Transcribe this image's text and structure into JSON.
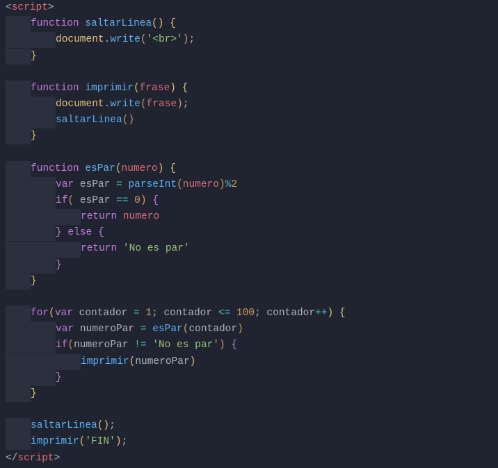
{
  "code": {
    "lines": [
      {
        "indent": 0,
        "tokens": [
          {
            "t": "<",
            "c": "punct"
          },
          {
            "t": "script",
            "c": "tag"
          },
          {
            "t": ">",
            "c": "punct"
          }
        ]
      },
      {
        "indent": 1,
        "tokens": [
          {
            "t": "function ",
            "c": "keyword"
          },
          {
            "t": "saltarLinea",
            "c": "funcdef"
          },
          {
            "t": "(",
            "c": "paren-y"
          },
          {
            "t": ")",
            "c": "paren-y"
          },
          {
            "t": " ",
            "c": ""
          },
          {
            "t": "{",
            "c": "brace-y"
          }
        ]
      },
      {
        "indent": 2,
        "tokens": [
          {
            "t": "document",
            "c": "object"
          },
          {
            "t": ".",
            "c": "punct"
          },
          {
            "t": "write",
            "c": "method"
          },
          {
            "t": "(",
            "c": "paren"
          },
          {
            "t": "'<br>'",
            "c": "string"
          },
          {
            "t": ")",
            "c": "paren"
          },
          {
            "t": ";",
            "c": "punct"
          }
        ]
      },
      {
        "indent": 1,
        "tokens": [
          {
            "t": "}",
            "c": "brace-y"
          }
        ]
      },
      {
        "indent": 0,
        "tokens": []
      },
      {
        "indent": 1,
        "tokens": [
          {
            "t": "function ",
            "c": "keyword"
          },
          {
            "t": "imprimir",
            "c": "funcdef"
          },
          {
            "t": "(",
            "c": "paren-y"
          },
          {
            "t": "frase",
            "c": "param"
          },
          {
            "t": ")",
            "c": "paren-y"
          },
          {
            "t": " ",
            "c": ""
          },
          {
            "t": "{",
            "c": "brace-y"
          }
        ]
      },
      {
        "indent": 2,
        "tokens": [
          {
            "t": "document",
            "c": "object"
          },
          {
            "t": ".",
            "c": "punct"
          },
          {
            "t": "write",
            "c": "method"
          },
          {
            "t": "(",
            "c": "paren"
          },
          {
            "t": "frase",
            "c": "param"
          },
          {
            "t": ")",
            "c": "paren"
          },
          {
            "t": ";",
            "c": "punct"
          }
        ]
      },
      {
        "indent": 2,
        "tokens": [
          {
            "t": "saltarLinea",
            "c": "funccall"
          },
          {
            "t": "(",
            "c": "paren"
          },
          {
            "t": ")",
            "c": "paren"
          }
        ]
      },
      {
        "indent": 1,
        "tokens": [
          {
            "t": "}",
            "c": "brace-y"
          }
        ]
      },
      {
        "indent": 0,
        "tokens": []
      },
      {
        "indent": 1,
        "tokens": [
          {
            "t": "function ",
            "c": "keyword"
          },
          {
            "t": "esPar",
            "c": "funcdef"
          },
          {
            "t": "(",
            "c": "paren-y"
          },
          {
            "t": "numero",
            "c": "param"
          },
          {
            "t": ")",
            "c": "paren-y"
          },
          {
            "t": " ",
            "c": ""
          },
          {
            "t": "{",
            "c": "brace-y"
          }
        ]
      },
      {
        "indent": 2,
        "tokens": [
          {
            "t": "var ",
            "c": "keyword"
          },
          {
            "t": "esPar",
            "c": "localvar"
          },
          {
            "t": " ",
            "c": ""
          },
          {
            "t": "=",
            "c": "op"
          },
          {
            "t": " ",
            "c": ""
          },
          {
            "t": "parseInt",
            "c": "funccall"
          },
          {
            "t": "(",
            "c": "paren"
          },
          {
            "t": "numero",
            "c": "param"
          },
          {
            "t": ")",
            "c": "paren"
          },
          {
            "t": "%",
            "c": "op"
          },
          {
            "t": "2",
            "c": "number"
          }
        ]
      },
      {
        "indent": 2,
        "tokens": [
          {
            "t": "if",
            "c": "keyword"
          },
          {
            "t": "(",
            "c": "paren"
          },
          {
            "t": " ",
            "c": ""
          },
          {
            "t": "esPar",
            "c": "localvar"
          },
          {
            "t": " ",
            "c": ""
          },
          {
            "t": "==",
            "c": "op"
          },
          {
            "t": " ",
            "c": ""
          },
          {
            "t": "0",
            "c": "number"
          },
          {
            "t": ")",
            "c": "paren"
          },
          {
            "t": " ",
            "c": ""
          },
          {
            "t": "{",
            "c": "brace-p"
          }
        ]
      },
      {
        "indent": 3,
        "tokens": [
          {
            "t": "return ",
            "c": "keyword"
          },
          {
            "t": "numero",
            "c": "param"
          }
        ]
      },
      {
        "indent": 2,
        "tokens": [
          {
            "t": "}",
            "c": "brace-p"
          },
          {
            "t": " ",
            "c": ""
          },
          {
            "t": "else ",
            "c": "keyword"
          },
          {
            "t": "{",
            "c": "brace-p"
          }
        ]
      },
      {
        "indent": 3,
        "tokens": [
          {
            "t": "return ",
            "c": "keyword"
          },
          {
            "t": "'No es par'",
            "c": "string"
          }
        ]
      },
      {
        "indent": 2,
        "tokens": [
          {
            "t": "}",
            "c": "brace-p"
          }
        ]
      },
      {
        "indent": 1,
        "tokens": [
          {
            "t": "}",
            "c": "brace-y"
          }
        ]
      },
      {
        "indent": 0,
        "tokens": []
      },
      {
        "indent": 1,
        "tokens": [
          {
            "t": "for",
            "c": "keyword"
          },
          {
            "t": "(",
            "c": "paren-y"
          },
          {
            "t": "var ",
            "c": "keyword"
          },
          {
            "t": "contador",
            "c": "localvar"
          },
          {
            "t": " ",
            "c": ""
          },
          {
            "t": "=",
            "c": "op"
          },
          {
            "t": " ",
            "c": ""
          },
          {
            "t": "1",
            "c": "number"
          },
          {
            "t": "; ",
            "c": "punct"
          },
          {
            "t": "contador",
            "c": "localvar"
          },
          {
            "t": " ",
            "c": ""
          },
          {
            "t": "<=",
            "c": "op"
          },
          {
            "t": " ",
            "c": ""
          },
          {
            "t": "100",
            "c": "number"
          },
          {
            "t": "; ",
            "c": "punct"
          },
          {
            "t": "contador",
            "c": "localvar"
          },
          {
            "t": "++",
            "c": "op"
          },
          {
            "t": ")",
            "c": "paren-y"
          },
          {
            "t": " ",
            "c": ""
          },
          {
            "t": "{",
            "c": "brace-y"
          }
        ]
      },
      {
        "indent": 2,
        "tokens": [
          {
            "t": "var ",
            "c": "keyword"
          },
          {
            "t": "numeroPar",
            "c": "localvar"
          },
          {
            "t": " ",
            "c": ""
          },
          {
            "t": "=",
            "c": "op"
          },
          {
            "t": " ",
            "c": ""
          },
          {
            "t": "esPar",
            "c": "funccall"
          },
          {
            "t": "(",
            "c": "paren"
          },
          {
            "t": "contador",
            "c": "localvar"
          },
          {
            "t": ")",
            "c": "paren"
          }
        ]
      },
      {
        "indent": 2,
        "tokens": [
          {
            "t": "if",
            "c": "keyword"
          },
          {
            "t": "(",
            "c": "paren"
          },
          {
            "t": "numeroPar",
            "c": "localvar"
          },
          {
            "t": " ",
            "c": ""
          },
          {
            "t": "!=",
            "c": "op"
          },
          {
            "t": " ",
            "c": ""
          },
          {
            "t": "'No es par'",
            "c": "string"
          },
          {
            "t": ")",
            "c": "paren"
          },
          {
            "t": " ",
            "c": ""
          },
          {
            "t": "{",
            "c": "brace-p"
          }
        ]
      },
      {
        "indent": 3,
        "tokens": [
          {
            "t": "imprimir",
            "c": "funccall"
          },
          {
            "t": "(",
            "c": "paren-y"
          },
          {
            "t": "numeroPar",
            "c": "localvar"
          },
          {
            "t": ")",
            "c": "paren-y"
          }
        ]
      },
      {
        "indent": 2,
        "tokens": [
          {
            "t": "}",
            "c": "brace-p"
          }
        ]
      },
      {
        "indent": 1,
        "tokens": [
          {
            "t": "}",
            "c": "brace-y"
          }
        ]
      },
      {
        "indent": 0,
        "tokens": []
      },
      {
        "indent": 1,
        "tokens": [
          {
            "t": "saltarLinea",
            "c": "funccall"
          },
          {
            "t": "(",
            "c": "paren-y"
          },
          {
            "t": ")",
            "c": "paren-y"
          },
          {
            "t": ";",
            "c": "punct"
          }
        ]
      },
      {
        "indent": 1,
        "tokens": [
          {
            "t": "imprimir",
            "c": "funccall"
          },
          {
            "t": "(",
            "c": "paren-y"
          },
          {
            "t": "'FIN'",
            "c": "string"
          },
          {
            "t": ")",
            "c": "paren-y"
          },
          {
            "t": ";",
            "c": "punct"
          }
        ]
      },
      {
        "indent": 0,
        "tokens": [
          {
            "t": "</",
            "c": "punct"
          },
          {
            "t": "script",
            "c": "tag"
          },
          {
            "t": ">",
            "c": "punct"
          }
        ]
      }
    ]
  }
}
